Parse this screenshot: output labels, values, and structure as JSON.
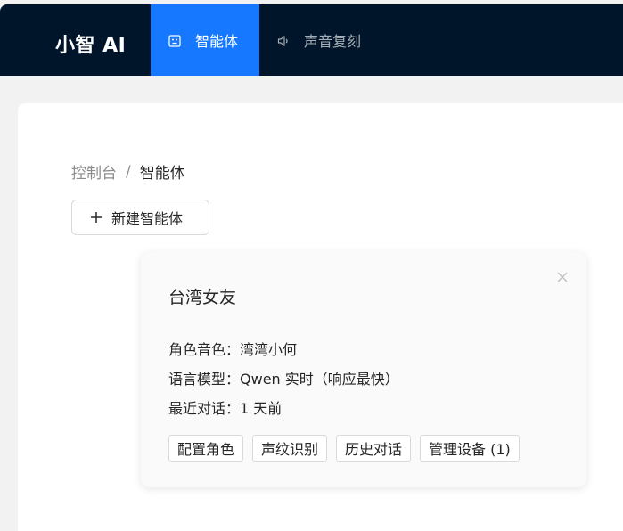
{
  "header": {
    "logo": "小智 AI",
    "nav": [
      {
        "label": "智能体",
        "icon": "robot-icon",
        "active": true
      },
      {
        "label": "声音复刻",
        "icon": "speaker-icon",
        "active": false
      }
    ],
    "colors": {
      "bar": "#001529",
      "active": "#1677ff"
    }
  },
  "breadcrumb": {
    "root": "控制台",
    "separator": "/",
    "current": "智能体"
  },
  "new_agent_button": {
    "icon": "plus-icon",
    "label": "新建智能体"
  },
  "agent_card": {
    "name": "台湾女友",
    "close_icon": "close-icon",
    "voice": {
      "label": "角色音色：",
      "value": "湾湾小何"
    },
    "model": {
      "label": "语言模型：",
      "value": "Qwen 实时（响应最快）"
    },
    "last_chat": {
      "label": "最近对话：",
      "value": "1 天前"
    },
    "actions": [
      "配置角色",
      "声纹识别",
      "历史对话",
      "管理设备 (1)"
    ]
  }
}
